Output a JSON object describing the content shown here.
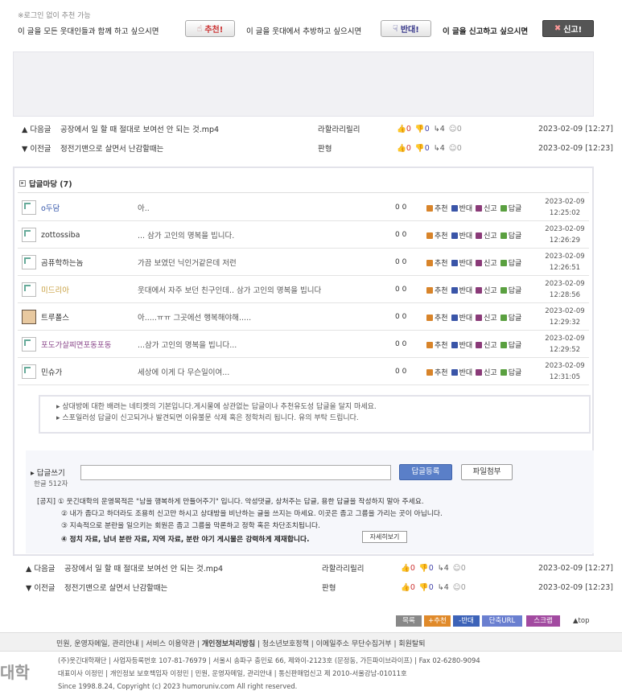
{
  "top": {
    "no_login": "※로그인 없이 추천 가능",
    "rec_text": "이 글을 모든 웃대인들과 함께 하고 싶으시면",
    "rec_label": "추천!",
    "opp_text": "이 글을 웃대에서 추방하고 싶으시면",
    "opp_label": "반대!",
    "rep_text": "이 글을 신고하고 싶으시면",
    "rep_label": "신고!"
  },
  "nav": [
    {
      "dir": "▲ 다음글",
      "title": "공장에서 일 할 때 절대로 보여선 안 되는 것.mp4",
      "author": "라할라리릴리",
      "rec": "0",
      "opp": "0",
      "view": "4",
      "comments": "0",
      "date": "2023-02-09 [12:27]"
    },
    {
      "dir": "▼ 이전글",
      "title": "정전기맨으로 살면서 난감할때는",
      "author": "판형",
      "rec": "0",
      "opp": "0",
      "view": "4",
      "comments": "0",
      "date": "2023-02-09 [12:23]"
    }
  ],
  "comments_header": "답글마당 (7)",
  "comment_actions": {
    "rec": "추천",
    "opp": "반대",
    "rep": "신고",
    "reply": "답글"
  },
  "comments": [
    {
      "nick": "o두담",
      "text": "아..",
      "nums": "0 0",
      "date": "2023-02-09",
      "time": "12:25:02",
      "nick_color": "#3355aa"
    },
    {
      "nick": "zottossiba",
      "text": "... 삼가 고인의 명복을 빕니다.",
      "nums": "0 0",
      "date": "2023-02-09",
      "time": "12:26:29",
      "nick_color": "#333333"
    },
    {
      "nick": "곰퓨학하는놈",
      "text": "가끔 보였던 닉인거같은데 저런",
      "nums": "0 0",
      "date": "2023-02-09",
      "time": "12:26:51",
      "nick_color": "#333333"
    },
    {
      "nick": "미드리아",
      "text": "웃대에서 자주 보던 친구인데.. 삼가 고인의 명복을 빕니다",
      "nums": "0 0",
      "date": "2023-02-09",
      "time": "12:28:56",
      "nick_color": "#c8a040"
    },
    {
      "nick": "트루폴스",
      "text": "아.....ㅠㅠ 그곳에선 행복해야해.....",
      "nums": "0 0",
      "date": "2023-02-09",
      "time": "12:29:32",
      "nick_color": "#333333"
    },
    {
      "nick": "포도가살찌면포동포동",
      "text": "...삼가 고인의 명복을 빕니다...",
      "nums": "0 0",
      "date": "2023-02-09",
      "time": "12:29:52",
      "nick_color": "#884488"
    },
    {
      "nick": "민슈가",
      "text": "세상에 이게 다 무슨일이여...",
      "nums": "0 0",
      "date": "2023-02-09",
      "time": "12:31:05",
      "nick_color": "#333333"
    }
  ],
  "notices": [
    "상대방에 대한 배려는 네티켓의 기본입니다.게시물에 상관없는 답글이나 추천유도성 답글을 달지 마세요.",
    "스포일러성 답글이 신고되거나 발견되면 이유불문 삭제 혹은 정학처리 됩니다. 유의 부탁 드립니다."
  ],
  "write": {
    "label": "답글쓰기",
    "limit": "한글 512자",
    "input_value": "",
    "submit_label": "답글등록",
    "attach_label": "파일첨부"
  },
  "rules": {
    "line1": "[공지] ① 웃긴대학의 운영목적은 \"남을 행복하게 만들어주기\" 입니다. 악성댓글, 상처주는 답글, 용한 답글을 작성하지 말아 주세요.",
    "line2": "② 내가 좀다고 하더라도 조용히 신고만 하시고 상대방을 비난하는 글을 쓰지는 마세요. 이곳은 좀고 그름을 가리는 곳이 아닙니다.",
    "line3": "③ 지속적으로 분란을 일으키는 회원은 좀고 그름을 막론하고 정학 혹은 차단조치됩니다.",
    "line4": "④ 정치 자료, 남녀 분란 자료, 지역 자료, 분란 야기 게시물은 강력하게 제재합니다.",
    "detail_label": "자세히보기"
  },
  "bottom_buttons": {
    "list": "목록",
    "rec": "+추천",
    "opp": "-반대",
    "short": "단축URL",
    "scrap": "스크랩",
    "top": "▲top"
  },
  "footer": {
    "links": [
      "민원, 운영자메일, 관리안내",
      "서비스 이용약관",
      "개인정보처리방침",
      "청소년보호정책",
      "이메일주소 무단수집거부",
      "회원탈퇴"
    ],
    "logo": "대학",
    "info1": "(주)웃긴대학재단 | 사업자등록번호 107-81-76979 | 서울시 송파구 충민로 66, 제와이-2123호 (문정동, 가든파이브라이프) | Fax 02-6280-9094",
    "info2": "대표이사 이정민 | 개인정보 보호책임자 이정민 | 민원, 운영자메일, 관리안내 | 통신판매업신고 제 2010-서울강남-01011호",
    "info3": "Since 1998.8.24, Copyright (c) 2023 humoruniv.com All right reserved."
  }
}
